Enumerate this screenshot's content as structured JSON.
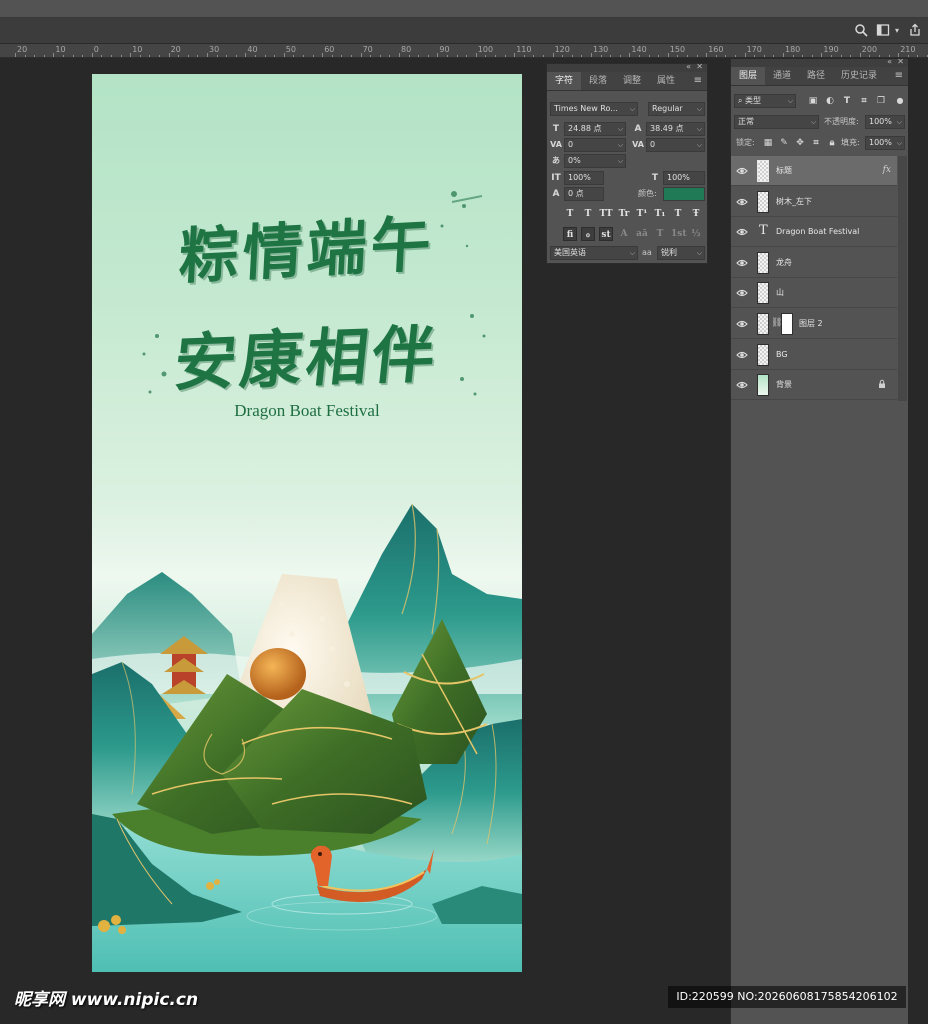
{
  "ruler": {
    "ticks": [
      "20",
      "10",
      "0",
      "10",
      "20",
      "30",
      "40",
      "50",
      "60",
      "70",
      "80",
      "90",
      "100",
      "110",
      "120",
      "130",
      "140",
      "150",
      "160",
      "170",
      "180",
      "190",
      "200",
      "210"
    ]
  },
  "poster": {
    "title_line1": "粽情端午",
    "title_line2": "安康相伴",
    "subtitle": "Dragon Boat Festival"
  },
  "character_panel": {
    "tabs": [
      "字符",
      "段落",
      "调整",
      "属性"
    ],
    "active_tab": "字符",
    "font_family": "Times New Ro...",
    "font_style": "Regular",
    "font_size": "24.88 点",
    "leading": "38.49 点",
    "kerning": "0",
    "tracking": "0",
    "tsume": "0%",
    "vertical_scale": "100%",
    "horizontal_scale": "100%",
    "baseline_shift": "0 点",
    "color_label": "颜色:",
    "color_value": "#1f7a55",
    "language": "美国英语",
    "aa_label": "aa",
    "antialias": "锐利",
    "type_buttons": [
      "T",
      "T",
      "TT",
      "Tr",
      "T¹",
      "T₁",
      "T",
      "Ŧ"
    ],
    "opentype_buttons": [
      "fi",
      "ℴ",
      "st",
      "A",
      "aā",
      "T",
      "1st",
      "½"
    ]
  },
  "layers_panel": {
    "tabs": [
      "图层",
      "通道",
      "路径",
      "历史记录"
    ],
    "active_tab": "图层",
    "filter_kind": "类型",
    "blend_mode": "正常",
    "opacity_label": "不透明度:",
    "opacity_value": "100%",
    "lock_label": "锁定:",
    "fill_label": "填充:",
    "fill_value": "100%",
    "layers": [
      {
        "name": "标题",
        "kind": "group",
        "selected": true,
        "fx": "fx"
      },
      {
        "name": "树木_左下",
        "kind": "pixel",
        "selected": false
      },
      {
        "name": "Dragon Boat Festival",
        "kind": "text",
        "selected": false
      },
      {
        "name": "龙舟",
        "kind": "pixel",
        "selected": false
      },
      {
        "name": "山",
        "kind": "pixel",
        "selected": false
      },
      {
        "name": "图层 2",
        "kind": "masked",
        "selected": false
      },
      {
        "name": "BG",
        "kind": "pixel",
        "selected": false
      },
      {
        "name": "背景",
        "kind": "background",
        "selected": false,
        "locked": true
      }
    ]
  },
  "watermark": {
    "site": "昵享网 www.nipic.cn",
    "id_text": "ID:220599 NO:20260608175854206102"
  }
}
